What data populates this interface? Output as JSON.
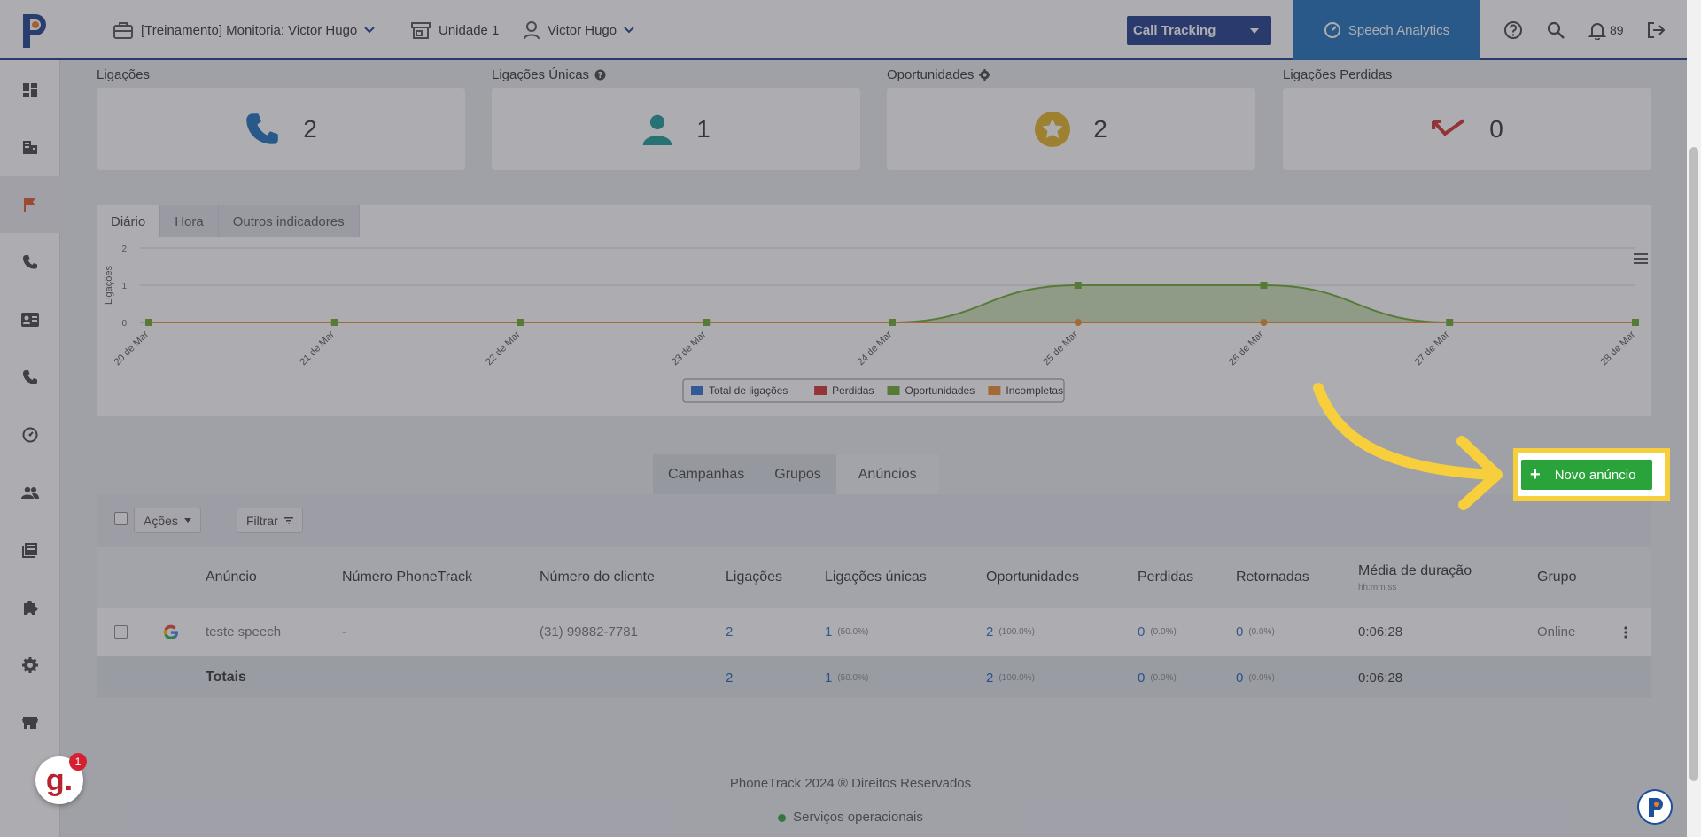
{
  "topbar": {
    "company": "[Treinamento] Monitoria: Victor Hugo",
    "unit": "Unidade 1",
    "user": "Victor Hugo",
    "product_select": "Call Tracking",
    "speech_analytics": "Speech Analytics",
    "notifications_count": "89"
  },
  "sidebar": {
    "items": [
      "dashboard-icon",
      "building-icon",
      "flag-icon",
      "phone-icon",
      "contact-card-icon",
      "phone-icon",
      "speed-icon",
      "people-icon",
      "book-icon",
      "puzzle-icon",
      "gear-icon",
      "store-icon"
    ]
  },
  "stats": [
    {
      "label": "Ligações",
      "value": "2",
      "icon": "phone-icon",
      "color": "#1d6fb8"
    },
    {
      "label": "Ligações Únicas",
      "value": "1",
      "icon": "person-icon",
      "color": "#1a9a9a"
    },
    {
      "label": "Oportunidades",
      "value": "2",
      "icon": "star-icon",
      "color": "#e6b422"
    },
    {
      "label": "Ligações Perdidas",
      "value": "0",
      "icon": "missed-call-icon",
      "color": "#d32f2f"
    }
  ],
  "chart_tabs": [
    "Diário",
    "Hora",
    "Outros indicadores"
  ],
  "chart_data": {
    "type": "area",
    "x": [
      "20 de Mar",
      "21 de Mar",
      "22 de Mar",
      "23 de Mar",
      "24 de Mar",
      "25 de Mar",
      "26 de Mar",
      "27 de Mar",
      "28 de Mar"
    ],
    "ylabel": "Ligações",
    "ylim": [
      0,
      2
    ],
    "yticks": [
      "0",
      "1",
      "2"
    ],
    "series": [
      {
        "name": "Total de ligações",
        "color": "#2f6fd6",
        "values": [
          0,
          0,
          0,
          0,
          0,
          0,
          0,
          0,
          0
        ]
      },
      {
        "name": "Perdidas",
        "color": "#d32f2f",
        "values": [
          0,
          0,
          0,
          0,
          0,
          0,
          0,
          0,
          0
        ]
      },
      {
        "name": "Oportunidades",
        "color": "#6aa92b",
        "values": [
          0,
          0,
          0,
          0,
          0,
          1,
          1,
          0,
          0
        ]
      },
      {
        "name": "Incompletas",
        "color": "#f08c2a",
        "values": [
          0,
          0,
          0,
          0,
          0,
          0,
          0,
          0,
          0
        ]
      }
    ],
    "legend": "bottom-center"
  },
  "section_tabs": [
    "Campanhas",
    "Grupos",
    "Anúncios"
  ],
  "toolbar": {
    "actions": "Ações",
    "filter": "Filtrar",
    "new_ad": "Novo anúncio"
  },
  "table": {
    "headers": {
      "ad": "Anúncio",
      "phonetrack": "Número PhoneTrack",
      "client": "Número do cliente",
      "calls": "Ligações",
      "unique": "Ligações únicas",
      "opps": "Oportunidades",
      "lost": "Perdidas",
      "returned": "Retornadas",
      "avg": "Média de duração",
      "avg_sub": "hh:mm:ss",
      "group": "Grupo"
    },
    "row": {
      "ad": "teste speech",
      "phonetrack": "-",
      "client": "(31) 99882-7781",
      "calls": "2",
      "unique": "1",
      "unique_pct": "(50.0%)",
      "opps": "2",
      "opps_pct": "(100.0%)",
      "lost": "0",
      "lost_pct": "(0.0%)",
      "returned": "0",
      "returned_pct": "(0.0%)",
      "avg": "0:06:28",
      "group": "Online"
    },
    "totals": {
      "label": "Totais",
      "calls": "2",
      "unique": "1",
      "unique_pct": "(50.0%)",
      "opps": "2",
      "opps_pct": "(100.0%)",
      "lost": "0",
      "lost_pct": "(0.0%)",
      "returned": "0",
      "returned_pct": "(0.0%)",
      "avg": "0:06:28"
    }
  },
  "footer": {
    "copyright": "PhoneTrack 2024 ® Direitos Reservados",
    "status": "Serviços operacionais"
  },
  "badge": {
    "letter": "g.",
    "count": "1"
  }
}
